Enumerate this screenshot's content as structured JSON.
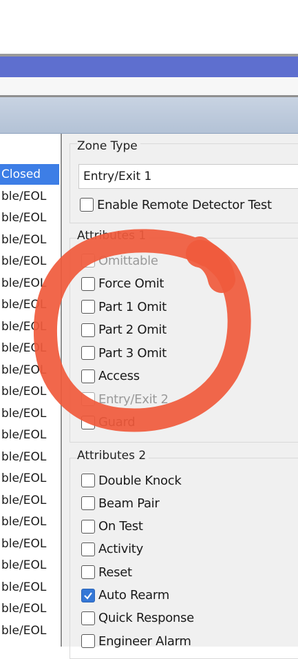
{
  "zone_type": {
    "label": "Zone Type",
    "value": "Entry/Exit 1",
    "remote_test_label": "Enable Remote Detector Test"
  },
  "zone_list": {
    "items": [
      "Closed",
      "ble/EOL",
      "ble/EOL",
      "ble/EOL",
      "ble/EOL",
      "ble/EOL",
      "ble/EOL",
      "ble/EOL",
      "ble/EOL",
      "ble/EOL",
      "ble/EOL",
      "ble/EOL",
      "ble/EOL",
      "ble/EOL",
      "ble/EOL",
      "ble/EOL",
      "ble/EOL",
      "ble/EOL",
      "ble/EOL",
      "ble/EOL",
      "ble/EOL",
      "ble/EOL"
    ],
    "selected_index": 0
  },
  "attributes1": {
    "label": "Attributes 1",
    "items": [
      {
        "label": "Omittable",
        "checked": false,
        "enabled": false
      },
      {
        "label": "Force Omit",
        "checked": false,
        "enabled": true
      },
      {
        "label": "Part 1 Omit",
        "checked": false,
        "enabled": true
      },
      {
        "label": "Part 2 Omit",
        "checked": false,
        "enabled": true
      },
      {
        "label": "Part 3 Omit",
        "checked": false,
        "enabled": true
      },
      {
        "label": "Access",
        "checked": false,
        "enabled": true
      },
      {
        "label": "Entry/Exit 2",
        "checked": false,
        "enabled": false
      },
      {
        "label": "Guard",
        "checked": false,
        "enabled": true
      }
    ]
  },
  "attributes2": {
    "label": "Attributes 2",
    "items": [
      {
        "label": "Double Knock",
        "checked": false,
        "enabled": true
      },
      {
        "label": "Beam Pair",
        "checked": false,
        "enabled": true
      },
      {
        "label": "On Test",
        "checked": false,
        "enabled": true
      },
      {
        "label": "Activity",
        "checked": false,
        "enabled": true
      },
      {
        "label": "Reset",
        "checked": false,
        "enabled": true
      },
      {
        "label": "Auto Rearm",
        "checked": true,
        "enabled": true
      },
      {
        "label": "Quick Response",
        "checked": false,
        "enabled": true
      },
      {
        "label": "Engineer Alarm",
        "checked": false,
        "enabled": true
      }
    ]
  },
  "colors": {
    "titlebar": "#5e6fcf",
    "selection": "#3d7ee6",
    "checkbox_checked": "#3477d6",
    "annotation_circle": "#f05a3c"
  },
  "annotation": {
    "shape": "freehand-circle",
    "highlights": "attributes1.force_omit..access"
  }
}
